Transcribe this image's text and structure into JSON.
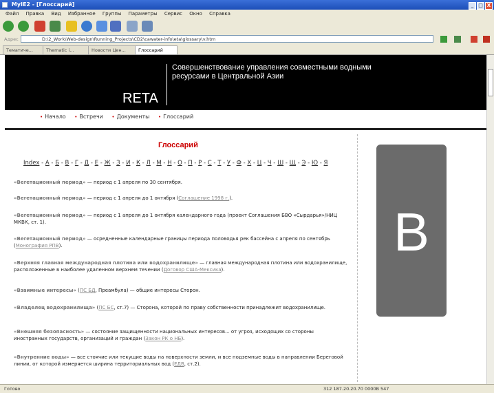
{
  "window": {
    "title": "MyIE2 - [Глоссарий]",
    "controls": [
      "_",
      "□",
      "X"
    ]
  },
  "menu": {
    "items": [
      "Файл",
      "Правка",
      "Вид",
      "Избранное",
      "Группы",
      "Параметры",
      "Сервис",
      "Окно",
      "Справка"
    ]
  },
  "address": {
    "label": "Адрес",
    "value": "D:\\2_Work\\Web-design\\Running_Projects\\CD2\\cawater-info\\eta\\glossary\\v.htm"
  },
  "tabs": [
    {
      "label": "Тематиче...",
      "active": false
    },
    {
      "label": "Thematic i...",
      "active": false
    },
    {
      "label": "Новости Цен...",
      "active": false
    },
    {
      "label": "Глоссарий",
      "active": true
    }
  ],
  "site": {
    "logo": "RETA",
    "title": "Совершенствование управления совместными водными ресурсами в Центральной Азии",
    "nav": [
      "Начало",
      "Встречи",
      "Документы",
      "Глоссарий"
    ],
    "nav_bullet": "•"
  },
  "glossary": {
    "title": "Глоссарий",
    "index_label": "Index",
    "letters": [
      "А",
      "Б",
      "В",
      "Г",
      "Д",
      "Е",
      "Ж",
      "З",
      "И",
      "К",
      "Л",
      "М",
      "Н",
      "О",
      "П",
      "Р",
      "С",
      "Т",
      "У",
      "Ф",
      "Х",
      "Ц",
      "Ч",
      "Ш",
      "Щ",
      "Э",
      "Ю",
      "Я"
    ],
    "big_letter": "B",
    "entries": [
      {
        "term": "«Вегетационный период»",
        "text": " — период с 1 апреля по 30 сентября.",
        "ref": ""
      },
      {
        "term": "«Вегетационный период»",
        "text": " — период с 1 апреля до 1 октября (",
        "ref": "Соглашение 1998 г.",
        "tail": ")."
      },
      {
        "term": "«Вегетационный период»",
        "text": " — период с 1 апреля до 1 октября календарного года (проект Соглашения БВО «Сырдарья»/НИЦ МКВК, ст. 1).",
        "ref": ""
      },
      {
        "term": "«Вегетационный период»",
        "text": " — осредненные календарные границы периода половодья рек бассейна с апреля по сентябрь (",
        "ref": "Монография РПВ",
        "tail": ")."
      },
      {
        "term": "«Верхняя главная международная плотина или водохранилище»",
        "text": " — главная международная плотина или водохранилище, расположенные в наиболее удаленном верхнем течении (",
        "ref": "Договор США-Мексика",
        "tail": ")."
      },
      {
        "term": "«Взаимные интересы»",
        "text": " (",
        "ref": "ПС БД",
        "tail": ", Преамбула) — общие интересы Сторон."
      },
      {
        "term": "«Владелец водохранилища»",
        "text": " (",
        "ref": "ПС БС",
        "tail": ", ст.7) — Сторона, которой по праву собственности принадлежит водохранилище."
      },
      {
        "term": "«Внешняя безопасность»",
        "text": " — состояние защищенности национальных интересов... от угроз, исходящих со стороны иностранных государств, организаций и граждан (",
        "ref": "Закон РК о НБ",
        "tail": ")."
      },
      {
        "term": "«Внутренние воды»",
        "text": " — все стоячие или текущие воды на поверхности земли, и все подземные воды в направлении Береговой линии, от которой измеряется ширина территориальных вод (",
        "ref": "ЕДВ",
        "tail": ", ст.2)."
      }
    ]
  },
  "status": {
    "left": "Готово",
    "right": "312     187.20.20.70     0000B 547"
  },
  "colors": {
    "header_bg": "#000000",
    "title_red": "#cc0000",
    "letter_box": "#6b6b6b",
    "titlebar": "#2a5fc8"
  }
}
